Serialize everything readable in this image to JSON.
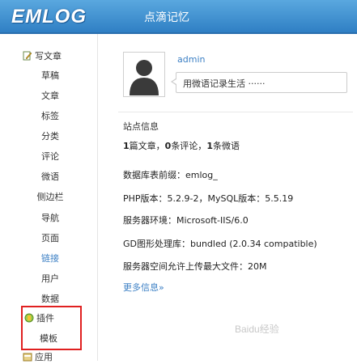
{
  "header": {
    "logo": "EMLOG",
    "site_name": "点滴记忆"
  },
  "sidebar": {
    "write_article": "写文章",
    "items": [
      {
        "label": "草稿"
      },
      {
        "label": "文章"
      },
      {
        "label": "标签"
      },
      {
        "label": "分类"
      },
      {
        "label": "评论"
      },
      {
        "label": "微语"
      },
      {
        "label": "侧边栏"
      },
      {
        "label": "导航"
      },
      {
        "label": "页面"
      },
      {
        "label": "链接"
      },
      {
        "label": "用户"
      },
      {
        "label": "数据"
      }
    ],
    "plugin": "插件",
    "template": "模板",
    "apps": "应用"
  },
  "profile": {
    "username": "admin",
    "twitter_placeholder": "用微语记录生活 ······"
  },
  "site_info": {
    "title": "站点信息",
    "stats": {
      "articles_count": "1",
      "articles_label": "篇文章，",
      "comments_count": "0",
      "comments_label": "条评论，",
      "twitters_count": "1",
      "twitters_label": "条微语"
    },
    "db_prefix": "数据库表前缀：emlog_",
    "php_version": "PHP版本：5.2.9-2，MySQL版本：5.5.19",
    "server_env": "服务器环境：Microsoft-IIS/6.0",
    "gd_lib": "GD图形处理库：bundled (2.0.34 compatible)",
    "upload_max": "服务器空间允许上传最大文件：20M",
    "more_link": "更多信息»"
  },
  "watermark": "Baidu经验"
}
